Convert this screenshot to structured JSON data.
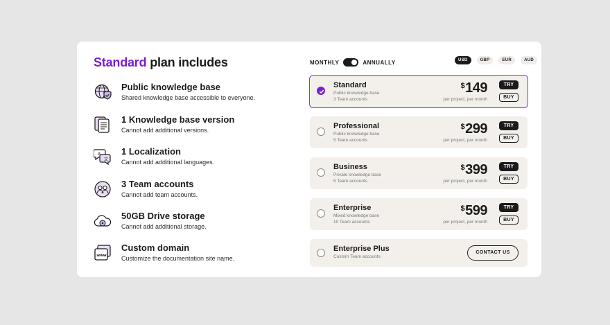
{
  "heading": {
    "accent": "Standard",
    "rest": " plan includes"
  },
  "features": [
    {
      "icon": "globe-shield-icon",
      "title": "Public knowledge base",
      "desc": "Shared knowledge base accessible to everyone."
    },
    {
      "icon": "documents-icon",
      "title": "1 Knowledge base version",
      "desc": "Cannot add additional versions."
    },
    {
      "icon": "translate-icon",
      "title": "1 Localization",
      "desc": "Cannot add additional languages."
    },
    {
      "icon": "team-icon",
      "title": "3 Team accounts",
      "desc": "Cannot add team accounts."
    },
    {
      "icon": "cloud-drive-icon",
      "title": "50GB Drive storage",
      "desc": "Cannot add additional storage."
    },
    {
      "icon": "domain-icon",
      "title": "Custom domain",
      "desc": "Customize the documentation site name."
    }
  ],
  "billing": {
    "monthly": "MONTHLY",
    "annually": "ANNUALLY",
    "selected": "ANNUALLY"
  },
  "currencies": [
    {
      "label": "USD",
      "active": true
    },
    {
      "label": "GBP",
      "active": false
    },
    {
      "label": "EUR",
      "active": false
    },
    {
      "label": "AUD",
      "active": false
    }
  ],
  "plans": [
    {
      "name": "Standard",
      "line1": "Public knowledge base",
      "line2": "3 Team accounts",
      "symbol": "$",
      "price": "149",
      "period": "per project, per month",
      "try": "TRY",
      "buy": "BUY",
      "selected": true
    },
    {
      "name": "Professional",
      "line1": "Public knowledge base",
      "line2": "5 Team accounts",
      "symbol": "$",
      "price": "299",
      "period": "per project, per month",
      "try": "TRY",
      "buy": "BUY",
      "selected": false
    },
    {
      "name": "Business",
      "line1": "Private knowledge base",
      "line2": "5 Team accounts",
      "symbol": "$",
      "price": "399",
      "period": "per project, per month",
      "try": "TRY",
      "buy": "BUY",
      "selected": false
    },
    {
      "name": "Enterprise",
      "line1": "Mixed knowledge base",
      "line2": "10 Team accounts",
      "symbol": "$",
      "price": "599",
      "period": "per project, per month",
      "try": "TRY",
      "buy": "BUY",
      "selected": false
    },
    {
      "name": "Enterprise Plus",
      "line1": "Custom Team accounts",
      "contact": "CONTACT US",
      "selected": false
    }
  ],
  "colors": {
    "accent": "#7a1fd0",
    "dark": "#1b1b1b",
    "plan_bg": "#f3f0ec",
    "page_bg": "#e6e6e6"
  }
}
